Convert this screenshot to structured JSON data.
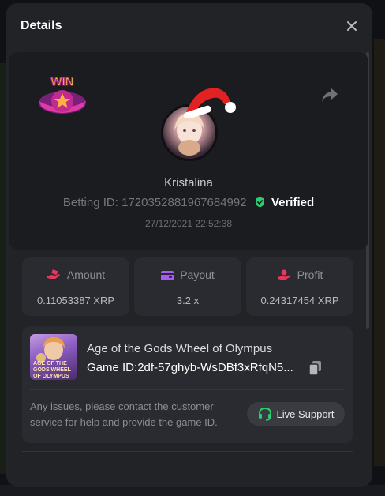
{
  "modal": {
    "title": "Details"
  },
  "profile": {
    "badge_text": "WIN",
    "username": "Kristalina",
    "betting_id_label": "Betting ID:",
    "betting_id": "1720352881967684992",
    "verified_label": "Verified",
    "date": "27/12/2021 22:52:38"
  },
  "stats": [
    {
      "label": "Amount",
      "value": "0.11053387 XRP",
      "icon": "coins-hand-icon",
      "color": "#e8365d"
    },
    {
      "label": "Payout",
      "value": "3.2 x",
      "icon": "wallet-icon",
      "color": "#a85cf5"
    },
    {
      "label": "Profit",
      "value": "0.24317454 XRP",
      "icon": "hand-coin-icon",
      "color": "#e8365d"
    }
  ],
  "game": {
    "name": "Age of the Gods Wheel of Olympus",
    "id_label": "Game ID:",
    "id_value": "2df-57ghyb-WsDBf3xRfqN5...",
    "thumb_text": "AGE OF THE GODS WHEEL OF OLYMPUS"
  },
  "support": {
    "message": "Any issues, please contact the customer service for help and provide the game ID.",
    "button_label": "Live Support"
  },
  "colors": {
    "verified": "#2ecc71",
    "live_support_icon": "#2ecc71",
    "accent_red": "#e8365d"
  }
}
